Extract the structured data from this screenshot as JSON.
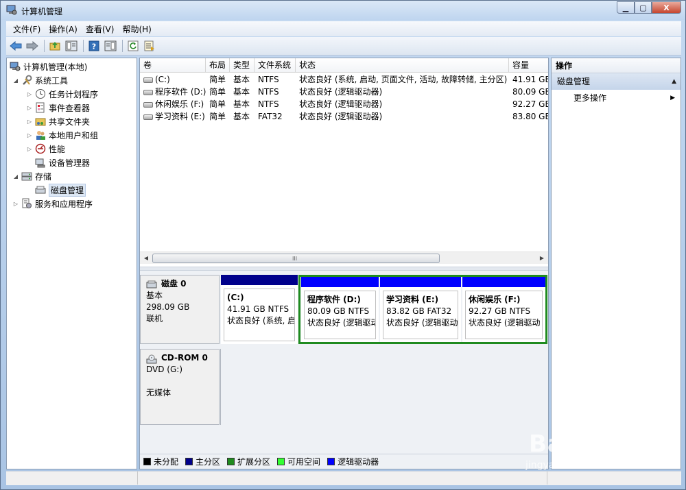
{
  "window": {
    "title": "计算机管理",
    "buttons": {
      "minimize": "▁",
      "maximize": "▢",
      "close": "X"
    }
  },
  "menu": [
    "文件(F)",
    "操作(A)",
    "查看(V)",
    "帮助(H)"
  ],
  "toolbar": [
    "back-icon",
    "forward-icon",
    "up-folder-icon",
    "show-hide-tree-icon",
    "help-icon",
    "show-hide-action-pane-icon",
    "refresh-icon",
    "export-list-icon"
  ],
  "tree": {
    "root": "计算机管理(本地)",
    "system_tools": "系统工具",
    "task_scheduler": "任务计划程序",
    "event_viewer": "事件查看器",
    "shared_folders": "共享文件夹",
    "local_users": "本地用户和组",
    "performance": "性能",
    "device_manager": "设备管理器",
    "storage": "存储",
    "disk_management": "磁盘管理",
    "services_apps": "服务和应用程序"
  },
  "volume_table": {
    "columns": [
      "卷",
      "布局",
      "类型",
      "文件系统",
      "状态",
      "容量"
    ],
    "rows": [
      [
        "(C:)",
        "简单",
        "基本",
        "NTFS",
        "状态良好 (系统, 启动, 页面文件, 活动, 故障转储, 主分区)",
        "41.91 GE"
      ],
      [
        "程序软件 (D:)",
        "简单",
        "基本",
        "NTFS",
        "状态良好 (逻辑驱动器)",
        "80.09 GE"
      ],
      [
        "休闲娱乐 (F:)",
        "简单",
        "基本",
        "NTFS",
        "状态良好 (逻辑驱动器)",
        "92.27 GE"
      ],
      [
        "学习资料 (E:)",
        "简单",
        "基本",
        "FAT32",
        "状态良好 (逻辑驱动器)",
        "83.80 GE"
      ]
    ],
    "scroll_grip": "III"
  },
  "disks": {
    "disk0": {
      "name": "磁盘 0",
      "type": "基本",
      "size": "298.09 GB",
      "status": "联机",
      "partitions": [
        {
          "name": "(C:)",
          "size": "41.91 GB NTFS",
          "status": "状态良好 (系统, 启",
          "color": "#00008b"
        },
        {
          "name": "程序软件  (D:)",
          "size": "80.09 GB NTFS",
          "status": "状态良好 (逻辑驱动",
          "color": "#0000ff"
        },
        {
          "name": "学习资料  (E:)",
          "size": "83.82 GB FAT32",
          "status": "状态良好 (逻辑驱动",
          "color": "#0000ff"
        },
        {
          "name": "休闲娱乐  (F:)",
          "size": "92.27 GB NTFS",
          "status": "状态良好 (逻辑驱动",
          "color": "#0000ff"
        }
      ]
    },
    "cdrom0": {
      "name": "CD-ROM 0",
      "type": "DVD (G:)",
      "status": "无媒体"
    }
  },
  "legend": [
    {
      "label": "未分配",
      "color": "#000000"
    },
    {
      "label": "主分区",
      "color": "#00008b"
    },
    {
      "label": "扩展分区",
      "color": "#1f8b1f"
    },
    {
      "label": "可用空间",
      "color": "#33ff33"
    },
    {
      "label": "逻辑驱动器",
      "color": "#0000ff"
    }
  ],
  "actions": {
    "header": "操作",
    "section": "磁盘管理",
    "more": "更多操作"
  },
  "watermark": {
    "text": "Bai 经验",
    "url": "jingyan.baidu.com"
  }
}
